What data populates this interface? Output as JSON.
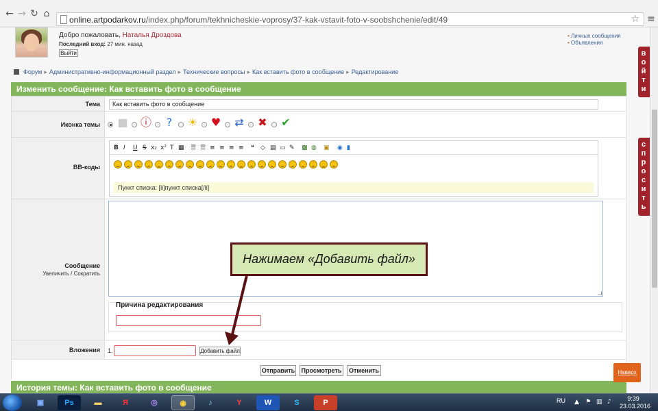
{
  "browser": {
    "url_host": "online.artpodarkov.ru",
    "url_path": "/index.php/forum/tekhnicheskie-voprosy/37-kak-vstavit-foto-v-soobshchenie/edit/49"
  },
  "user_panel": {
    "welcome": "Добро пожаловать,",
    "username": "Наталья Дроздова",
    "last_login_label": "Последний вход:",
    "last_login_value": "27 мин. назад",
    "logout_label": "Выйти",
    "links": [
      "Личные сообщения",
      "Объявления"
    ]
  },
  "breadcrumb": [
    "Форум",
    "Административно-информационный раздел",
    "Технические вопросы",
    "Как вставить фото в сообщение",
    "Редактирование"
  ],
  "edit_header": "Изменить сообщение: Как вставить фото в сообщение",
  "form": {
    "subject_label": "Тема",
    "subject_value": "Как вставить фото в сообщение",
    "topic_icon_label": "Иконка темы",
    "bbcode_label": "BB-коды",
    "bbcode_hint": "Пункт списка: [li]пункт списка[/li]",
    "message_label": "Сообщение",
    "message_enlarge": "Увеличить",
    "message_shrink": "Сократить",
    "edit_reason_label": "Причина редактирования",
    "attachments_label": "Вложения",
    "attachment_number": "1.",
    "add_file_label": "Добавить файл"
  },
  "actions": {
    "submit": "Отправить",
    "preview": "Просмотреть",
    "cancel": "Отменить"
  },
  "history_header": "История темы: Как вставить фото в сообщение",
  "callout_text": "Нажимаем «Добавить файл»",
  "side_tabs": {
    "login": "войти",
    "ask": "спросить"
  },
  "back_to_top": "Наверх",
  "taskbar": {
    "lang": "RU",
    "time": "9:39",
    "date": "23.03.2016"
  }
}
